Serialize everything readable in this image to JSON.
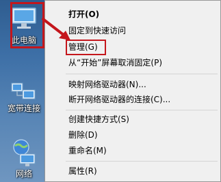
{
  "desktop": {
    "icons": [
      {
        "label": "此电脑"
      },
      {
        "label": "宽带连接"
      },
      {
        "label": "网络"
      }
    ]
  },
  "context_menu": {
    "items": [
      {
        "label": "打开(O)",
        "bold": true
      },
      {
        "label": "固定到快速访问"
      },
      {
        "label": "管理(G)"
      },
      {
        "label": "从“开始”屏幕取消固定(P)"
      },
      {
        "label": "映射网络驱动器(N)..."
      },
      {
        "label": "断开网络驱动器的连接(C)..."
      },
      {
        "label": "创建快捷方式(S)"
      },
      {
        "label": "删除(D)"
      },
      {
        "label": "重命名(M)"
      },
      {
        "label": "属性(R)"
      }
    ]
  },
  "colors": {
    "annotation_red": "#c4161c",
    "menu_background": "#f0f0f0"
  }
}
